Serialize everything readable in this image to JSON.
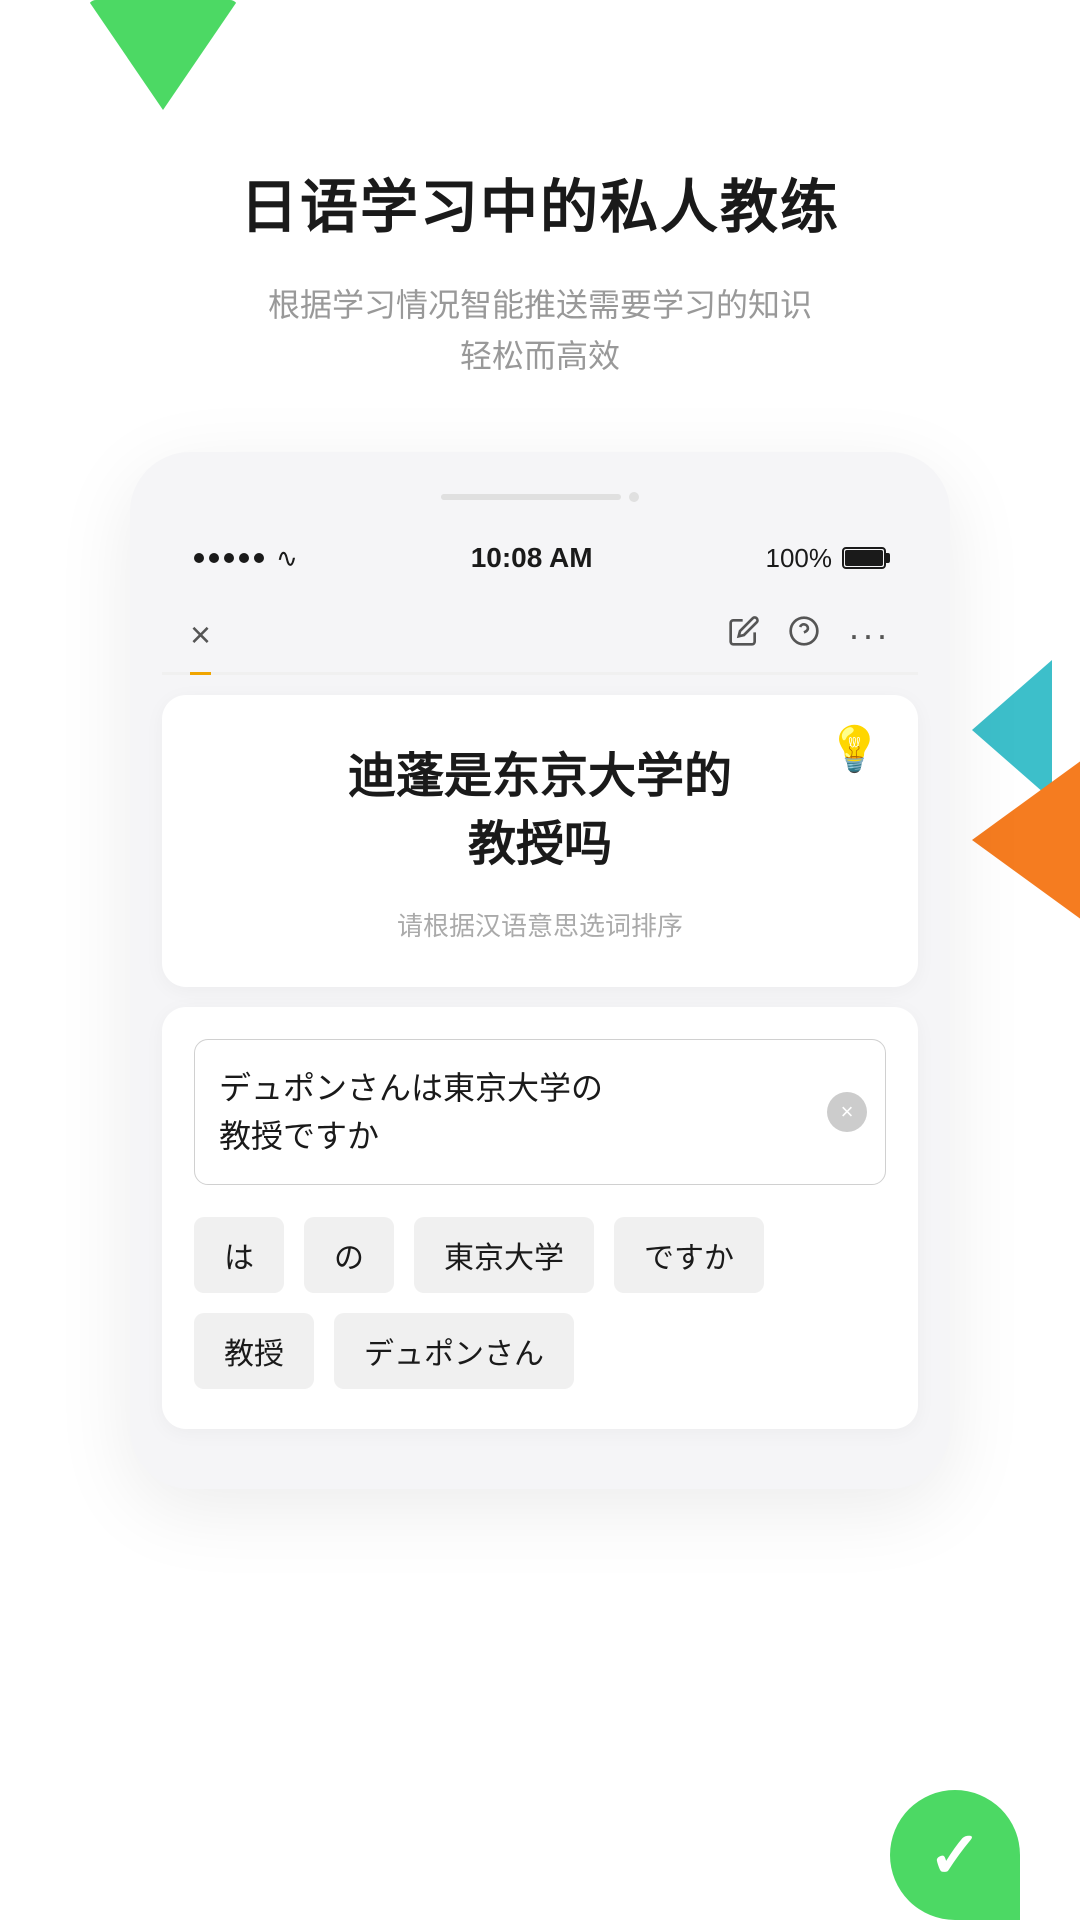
{
  "page": {
    "background": "#ffffff"
  },
  "header": {
    "title": "日语学习中的私人教练",
    "subtitle_line1": "根据学习情况智能推送需要学习的知识",
    "subtitle_line2": "轻松而高效"
  },
  "status_bar": {
    "time": "10:08 AM",
    "battery_pct": "100%",
    "signal_dots": 5
  },
  "nav": {
    "close_icon": "×",
    "edit_icon": "✏",
    "help_icon": "?",
    "more_icon": "···"
  },
  "question_card": {
    "main_text_line1": "迪蓬是东京大学的",
    "main_text_line2": "教授吗",
    "hint_text": "请根据汉语意思选词排序",
    "hint_icon": "💡"
  },
  "answer_area": {
    "current_answer_line1": "デュポンさんは東京大学の",
    "current_answer_line2": "教授ですか",
    "clear_label": "×"
  },
  "word_chips": [
    {
      "id": 1,
      "label": "は"
    },
    {
      "id": 2,
      "label": "の"
    },
    {
      "id": 3,
      "label": "東京大学"
    },
    {
      "id": 4,
      "label": "ですか"
    },
    {
      "id": 5,
      "label": "教授"
    },
    {
      "id": 6,
      "label": "デュポンさん"
    }
  ],
  "decorations": {
    "top_triangle_color": "#4cd964",
    "right_teal_color": "#3dbfca",
    "right_orange_color": "#f57c20",
    "bottom_check_color": "#4cd964"
  }
}
